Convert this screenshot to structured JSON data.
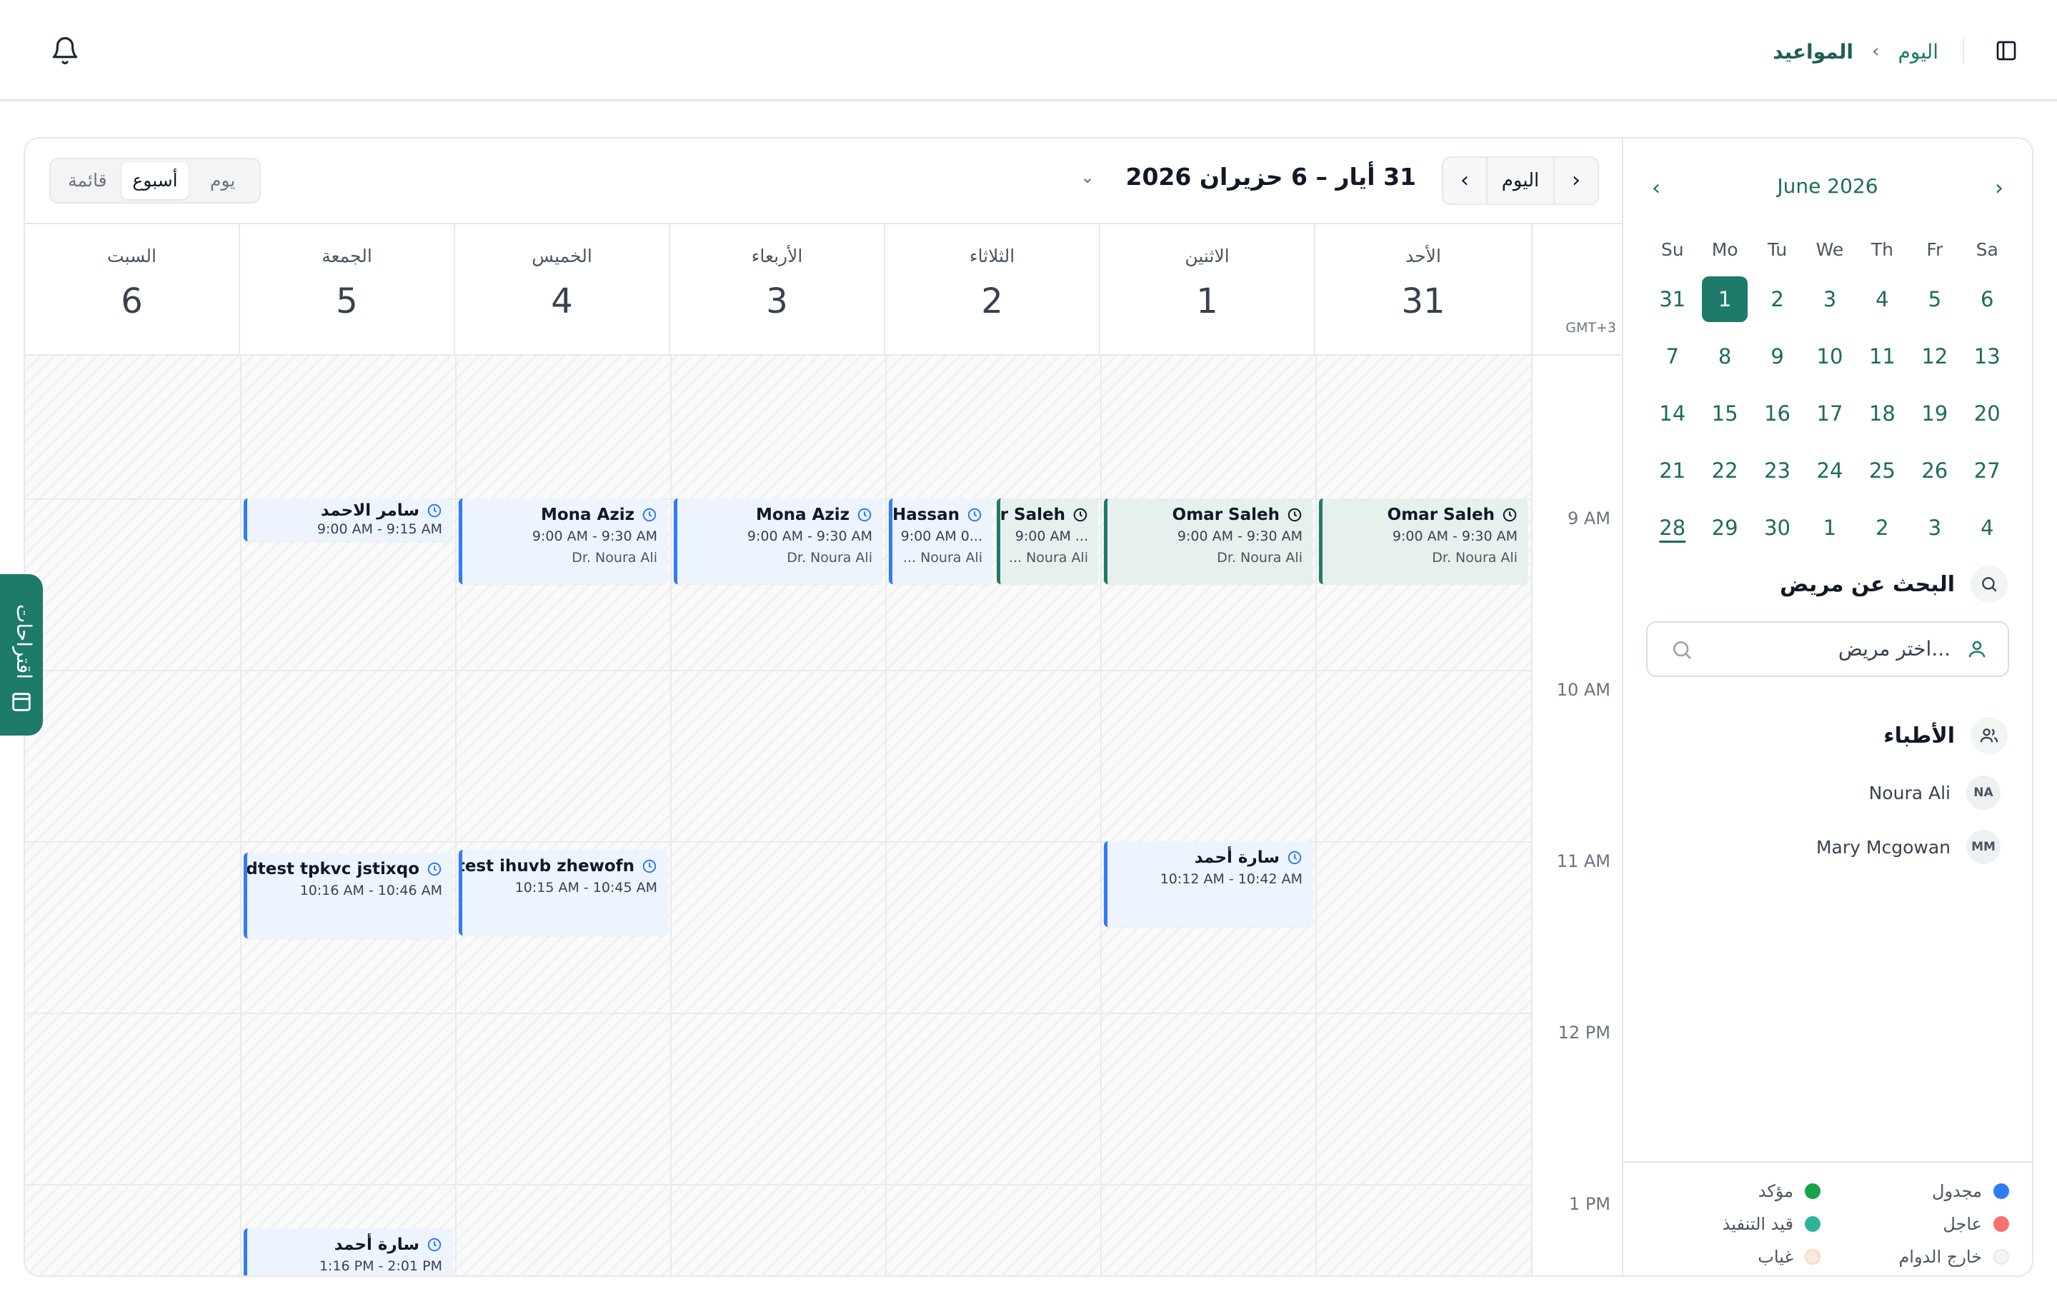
{
  "header": {
    "breadcrumb_today": "اليوم",
    "breadcrumb_current": "المواعيد",
    "bell_icon": "bell-icon",
    "sidebar_icon": "sidebar-toggle-icon"
  },
  "toolbar": {
    "today_button": "اليوم",
    "range_title": "31 أيار – 6 حزيران 2026",
    "views": [
      "قائمة",
      "أسبوع",
      "يوم"
    ],
    "active_view": "أسبوع"
  },
  "timezone": "GMT+3",
  "days": [
    {
      "name": "الأحد",
      "num": "31"
    },
    {
      "name": "الاثنين",
      "num": "1"
    },
    {
      "name": "الثلاثاء",
      "num": "2"
    },
    {
      "name": "الأربعاء",
      "num": "3"
    },
    {
      "name": "الخميس",
      "num": "4"
    },
    {
      "name": "الجمعة",
      "num": "5"
    },
    {
      "name": "السبت",
      "num": "6"
    }
  ],
  "time_labels": [
    "9 AM",
    "10 AM",
    "11 AM",
    "12 PM",
    "1 PM"
  ],
  "events": [
    {
      "title": "Omar Saleh",
      "time": "9:00 AM - 9:30 AM",
      "doctor": "Dr. Noura Ali",
      "status": "confirmed"
    },
    {
      "title": "Omar Saleh",
      "time": "9:00 AM - 9:30 AM",
      "doctor": "Dr. Noura Ali",
      "status": "confirmed"
    },
    {
      "title": "سارة أحمد",
      "time": "10:12 AM - 10:42 AM",
      "status": "scheduled"
    },
    {
      "title": "r Saleh",
      "time": "9:00 AM ...",
      "doctor": "... Noura Ali",
      "status": "confirmed"
    },
    {
      "title": "Hassan",
      "time": "9:00 AM 0...",
      "doctor": "... Noura Ali",
      "status": "scheduled"
    },
    {
      "title": "Mona Aziz",
      "time": "9:00 AM - 9:30 AM",
      "doctor": "Dr. Noura Ali",
      "status": "scheduled"
    },
    {
      "title": "Mona Aziz",
      "time": "9:00 AM - 9:30 AM",
      "doctor": "Dr. Noura Ali",
      "status": "scheduled"
    },
    {
      "title": "adtest ihuvb zhewofn",
      "time": "10:15 AM - 10:45 AM",
      "status": "scheduled"
    },
    {
      "title": "سامر الاحمد",
      "time": "9:00 AM - 9:15 AM",
      "status": "scheduled"
    },
    {
      "title": "Loadtest tpkvc jstixqo",
      "time": "10:16 AM - 10:46 AM",
      "status": "scheduled"
    },
    {
      "title": "سارة أحمد",
      "time": "1:16 PM - 2:01 PM",
      "status": "scheduled"
    }
  ],
  "suggestions_tab": "اقتراحات",
  "mini_calendar": {
    "title": "June 2026",
    "weekdays": [
      "Su",
      "Mo",
      "Tu",
      "We",
      "Th",
      "Fr",
      "Sa"
    ],
    "weeks": [
      [
        "31",
        "1",
        "2",
        "3",
        "4",
        "5",
        "6"
      ],
      [
        "7",
        "8",
        "9",
        "10",
        "11",
        "12",
        "13"
      ],
      [
        "14",
        "15",
        "16",
        "17",
        "18",
        "19",
        "20"
      ],
      [
        "21",
        "22",
        "23",
        "24",
        "25",
        "26",
        "27"
      ],
      [
        "28",
        "29",
        "30",
        "1",
        "2",
        "3",
        "4"
      ]
    ],
    "selected": "1",
    "today": "28"
  },
  "patient_search": {
    "title": "البحث عن مريض",
    "placeholder": "اختر مريض..."
  },
  "doctors": {
    "title": "الأطباء",
    "items": [
      {
        "initials": "NA",
        "name": "Noura Ali"
      },
      {
        "initials": "MM",
        "name": "Mary Mcgowan"
      }
    ]
  },
  "legend": [
    {
      "label": "مجدول",
      "color": "#2f7cf6"
    },
    {
      "label": "مؤكد",
      "color": "#16a34a"
    },
    {
      "label": "عاجل",
      "color": "#f87171"
    },
    {
      "label": "قيد التنفيذ",
      "color": "#2bb39a"
    },
    {
      "label": "خارج الدوام",
      "color": "#f3f4f6"
    },
    {
      "label": "غياب",
      "color": "#fde8dc"
    }
  ]
}
